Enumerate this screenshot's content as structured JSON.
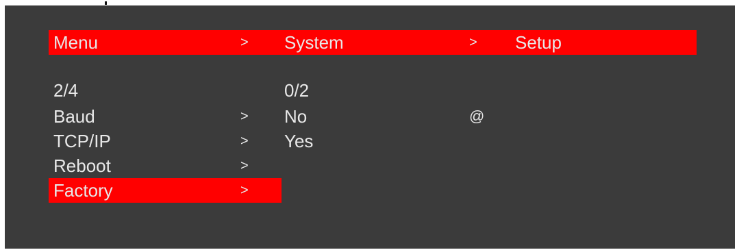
{
  "header": {
    "col1": "Menu",
    "sep1": ">",
    "col2": "System",
    "sep2": ">",
    "col3": "Setup"
  },
  "page_indicator": "2/4",
  "option_indicator": "0/2",
  "menu_items": [
    {
      "label": "Baud",
      "arrow": ">"
    },
    {
      "label": "TCP/IP",
      "arrow": ">"
    },
    {
      "label": "Reboot",
      "arrow": ">"
    },
    {
      "label": "Factory",
      "arrow": ">"
    }
  ],
  "options": [
    "No",
    "Yes"
  ],
  "marker": "@",
  "colors": {
    "accent": "#ff0000",
    "background": "#3b3b3b",
    "text": "#e8e8e8"
  }
}
